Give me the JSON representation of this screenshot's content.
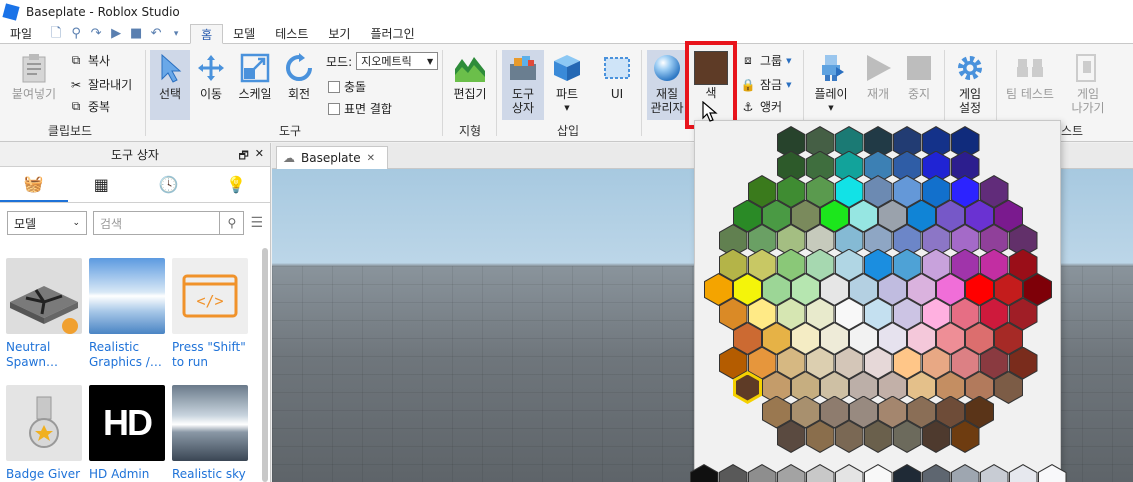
{
  "window": {
    "title": "Baseplate - Roblox Studio"
  },
  "menu": {
    "file": "파일",
    "tabs": [
      "홈",
      "모델",
      "테스트",
      "보기",
      "플러그인"
    ]
  },
  "ribbon": {
    "clipboard": {
      "paste": "붙여넣기",
      "copy": "복사",
      "cut": "잘라내기",
      "duplicate": "중복",
      "label": "클립보드"
    },
    "tools": {
      "select": "선택",
      "move": "이동",
      "scale": "스케일",
      "rotate": "회전",
      "mode_label": "모드:",
      "mode_value": "지오메트릭",
      "collisions": "충돌",
      "join_surfaces": "표면 결합",
      "label": "도구"
    },
    "terrain": {
      "editor": "편집기",
      "label": "지형"
    },
    "insert": {
      "toolbox": "도구\n상자",
      "part": "파트",
      "ui": "UI",
      "label": "삽입"
    },
    "edit": {
      "material": "재질\n관리자",
      "color": "색",
      "group": "그룹",
      "lock": "잠금",
      "anchor": "앵커"
    },
    "test": {
      "play": "플레이",
      "resume": "재개",
      "stop": "중지",
      "game_settings": "게임\n설정",
      "team_test": "팀 테스트",
      "exit_game": "게임\n나가기",
      "label": "스트"
    },
    "color_swatch": "#5e3b26"
  },
  "toolbox": {
    "title": "도구 상자",
    "category": "모델",
    "search_placeholder": "검색",
    "assets": [
      {
        "label": "Neutral Spawn…"
      },
      {
        "label": "Realistic Graphics /…"
      },
      {
        "label": "Press \"Shift\" to run"
      },
      {
        "label": "Badge Giver"
      },
      {
        "label": "HD Admin"
      },
      {
        "label": "Realistic sky"
      }
    ],
    "hd_text": "HD"
  },
  "document": {
    "tab": "Baseplate"
  },
  "palette": {
    "rows": [
      [
        "#27432c",
        "#455f45",
        "#1b7a74",
        "#213a46",
        "#223c73",
        "#14328a",
        "#102b7c"
      ],
      [
        "#2d5a2a",
        "#3f6e3e",
        "#12a39b",
        "#3c80b4",
        "#2f5da6",
        "#2024d4",
        "#2c1e8e"
      ],
      [
        "#3a7a1c",
        "#3f8c32",
        "#5a9a4e",
        "#12e2e6",
        "#6c8ab2",
        "#6498d8",
        "#1270cc",
        "#2c23ff",
        "#612c7a"
      ],
      [
        "#2a8a26",
        "#4a9a44",
        "#7a8a5c",
        "#1ce61c",
        "#96e6e2",
        "#9aa2ac",
        "#1084d6",
        "#7658c8",
        "#6a32d2",
        "#7a1a8e"
      ],
      [
        "#618050",
        "#6aa064",
        "#a4be82",
        "#c6cabc",
        "#85bad4",
        "#8ea6c4",
        "#6c86c8",
        "#8c76c6",
        "#a46ac8",
        "#90409a",
        "#62306a"
      ],
      [
        "#b4b448",
        "#c8c864",
        "#8ac878",
        "#a6d8b0",
        "#b0d6e4",
        "#1b8ee0",
        "#4ea2d6",
        "#c8a2dc",
        "#a034aa",
        "#c22ea2",
        "#9a0e18"
      ],
      [
        "#f4a400",
        "#f4f40a",
        "#9cd696",
        "#b6e6b0",
        "#e6e6e6",
        "#b4d0e2",
        "#c0bce0",
        "#dab2de",
        "#f06ed8",
        "#ff0000",
        "#c41c1c",
        "#7e0008"
      ],
      [
        "#da8a26",
        "#ffea86",
        "#d6e6b2",
        "#e8eacc",
        "#f8f8f8",
        "#c4e0f0",
        "#ccc4e4",
        "#ffb0e0",
        "#e66e84",
        "#ce1a3c",
        "#a01e26"
      ],
      [
        "#cc6a32",
        "#e6b246",
        "#f4ecc4",
        "#eeebd8",
        "#f2f2f2",
        "#e6e2ee",
        "#f4c8da",
        "#ee8e96",
        "#dc6e6e",
        "#a62a26"
      ],
      [
        "#b45c00",
        "#e6963c",
        "#d6b882",
        "#dccfb0",
        "#d4c6b8",
        "#e6d8d8",
        "#ffc688",
        "#e8a884",
        "#dc8084",
        "#8a3a40",
        "#7a2c1c"
      ],
      [
        "#5e3b26",
        "#c49c6a",
        "#c6ae80",
        "#cec0a4",
        "#bcafa8",
        "#c2b0a8",
        "#e4c08a",
        "#c48e62",
        "#b27a5c",
        "#7c5c46"
      ],
      [
        "#9a7850",
        "#a8906e",
        "#8e7c6e",
        "#988a80",
        "#a4866e",
        "#8a6e56",
        "#6e4c38",
        "#5a3418"
      ],
      [
        "#5a4a40",
        "#8a6e4c",
        "#7a6854",
        "#6a604c",
        "#6c6a5c",
        "#4e3a2e",
        "#6e3c10"
      ]
    ],
    "grays": [
      "#101010",
      "#595959",
      "#8e8e8e",
      "#a3a3a3",
      "#c8c8c8",
      "#e4e4e4",
      "#f8f8f8",
      "#1f2a36",
      "#5e6670",
      "#9ea6b0",
      "#c8ccd4",
      "#e6e8ee",
      "#f8f8fa"
    ],
    "selected": [
      10,
      0
    ]
  }
}
